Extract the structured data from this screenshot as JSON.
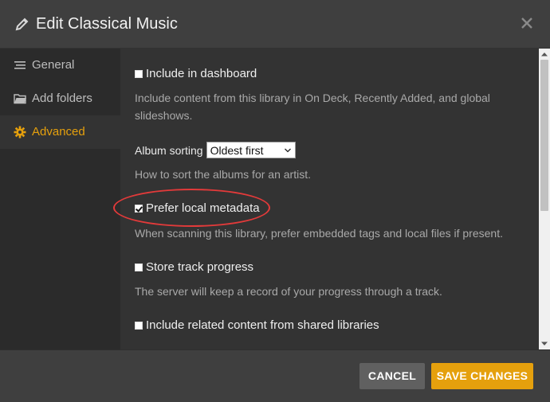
{
  "dialog": {
    "title": "Edit Classical Music",
    "icons": {
      "title": "pencil-icon",
      "close": "close-icon"
    }
  },
  "sidebar": {
    "items": [
      {
        "label": "General",
        "icon": "list-icon",
        "active": false
      },
      {
        "label": "Add folders",
        "icon": "folder-icon",
        "active": false
      },
      {
        "label": "Advanced",
        "icon": "gear-icon",
        "active": true
      }
    ]
  },
  "settings": {
    "include_dashboard": {
      "label": "Include in dashboard",
      "checked": false,
      "description": "Include content from this library in On Deck, Recently Added, and global slideshows."
    },
    "album_sorting": {
      "label": "Album sorting",
      "value": "Oldest first",
      "description": "How to sort the albums for an artist."
    },
    "prefer_local_metadata": {
      "label": "Prefer local metadata",
      "checked": true,
      "description": "When scanning this library, prefer embedded tags and local files if present."
    },
    "store_track_progress": {
      "label": "Store track progress",
      "checked": false,
      "description": "The server will keep a record of your progress through a track."
    },
    "include_related": {
      "label": "Include related content from shared libraries",
      "checked": false
    }
  },
  "footer": {
    "cancel_label": "CANCEL",
    "save_label": "SAVE CHANGES"
  },
  "colors": {
    "accent": "#e5a00d",
    "annotation": "#e23a3a",
    "background": "#3f3f3f",
    "sidebar": "#2b2b2b",
    "content": "#333333"
  }
}
